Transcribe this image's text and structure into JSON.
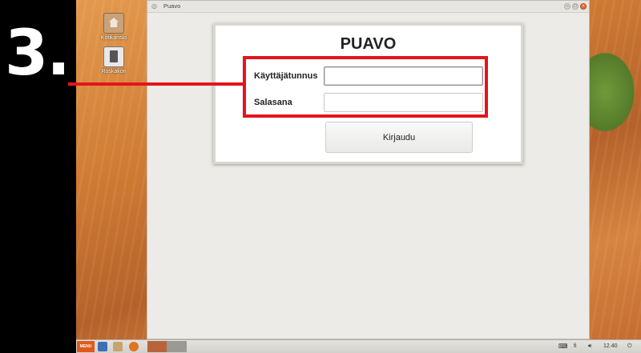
{
  "tutorial": {
    "step": "3."
  },
  "desktop": {
    "icons": [
      {
        "label": "Kotikansio",
        "icon": "home-folder-icon"
      },
      {
        "label": "Roskakori",
        "icon": "trash-icon"
      }
    ]
  },
  "window": {
    "title": "Puavo",
    "buttons": {
      "minimize": "–",
      "maximize": "□",
      "close": "×"
    }
  },
  "login": {
    "heading": "PUAVO",
    "username_label": "Käyttäjätunnus",
    "username_value": "",
    "password_label": "Salasana",
    "password_value": "",
    "submit_label": "Kirjaudu"
  },
  "taskbar": {
    "menu_label": "MENU",
    "keyboard_layout": "fi",
    "time": "12.40"
  },
  "colors": {
    "highlight": "#e3151c",
    "menu_button": "#e05a1c"
  }
}
